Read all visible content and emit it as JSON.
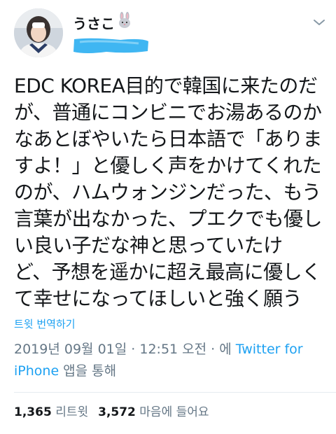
{
  "user": {
    "display_name": "うさこ",
    "name_emoji": "rabbit-emoji",
    "handle": "",
    "avatar": "profile-photo"
  },
  "tweet": {
    "text": "EDC KOREA目的で韓国に来たのだ\nが、普通にコンビニでお湯あるのか\nなあとぼやいたら日本語で「ありま\nすよ！」と優しく声をかけてくれた\nのが、ハムウォンジンだった、もう\n言葉が出なかった、プエクでも優し\nい良い子だな神と思っていたけ\nど、予想を遥かに超え最高に優しく\nて幸せになってほしいと強く願う",
    "translate_label": "트윗 번역하기"
  },
  "meta": {
    "date": "2019년 09월 01일",
    "separator1": " · ",
    "time": "12:51 오전",
    "separator2": " · 에 ",
    "client_line1": "Twitter for",
    "client_line2": "iPhone",
    "client_suffix": " 앱을 통해"
  },
  "stats": {
    "retweets_count": "1,365",
    "retweets_label": "리트윗",
    "likes_count": "3,572",
    "likes_label": "마음에 들어요"
  },
  "colors": {
    "link": "#1da1f2",
    "secondary": "#657786",
    "redaction": "#3fb6f2"
  }
}
